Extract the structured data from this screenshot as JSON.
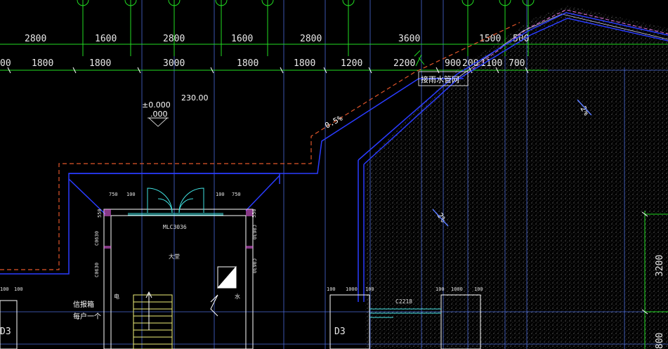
{
  "drawing": {
    "dims_top_row": [
      "2800",
      "1600",
      "2800",
      "1600",
      "2800",
      "3600",
      "1500",
      "500"
    ],
    "dims_second_row": [
      "00",
      "1800",
      "1800",
      "3000",
      "1800",
      "1800",
      "1200",
      "2200",
      "900",
      "200",
      "1100",
      "700"
    ],
    "elevation": {
      "upper": "±0.000",
      "lower": ".000",
      "value": "230.00"
    },
    "labels": {
      "rain_pipe": "接雨水管网",
      "hall": "大堂",
      "door_code": "MLC3036",
      "window_code": "C2218",
      "letterbox": "信报箱",
      "per_household": "每户一个",
      "electric": "电",
      "water": "水"
    },
    "slopes": [
      "0.5%",
      "2%",
      "2%"
    ],
    "right_dims": [
      "3200",
      "800"
    ],
    "small_dims": {
      "top_left": [
        "750",
        "100"
      ],
      "top_right": [
        "100",
        "750"
      ],
      "side": [
        "550",
        "550"
      ],
      "windows": [
        "C0630",
        "C0630",
        "C0630",
        "C0630"
      ],
      "bottom_left": [
        "100",
        "1000",
        "100"
      ],
      "bottom_right": [
        "100",
        "1000",
        "100"
      ],
      "misc": [
        "100",
        "100",
        "D3",
        "D3"
      ]
    },
    "colors": {
      "background": "#000000",
      "axis_green": "#22dd22",
      "wall_white": "#ffffff",
      "grid_blue": "#4a6bd8",
      "outline_blue": "#2a3cff",
      "dash_red": "#e0552a",
      "magenta": "#e070e0",
      "hatch": "#8a8a8a",
      "stair_yellow": "#f0f07a",
      "door_cyan": "#40e0e0"
    }
  }
}
